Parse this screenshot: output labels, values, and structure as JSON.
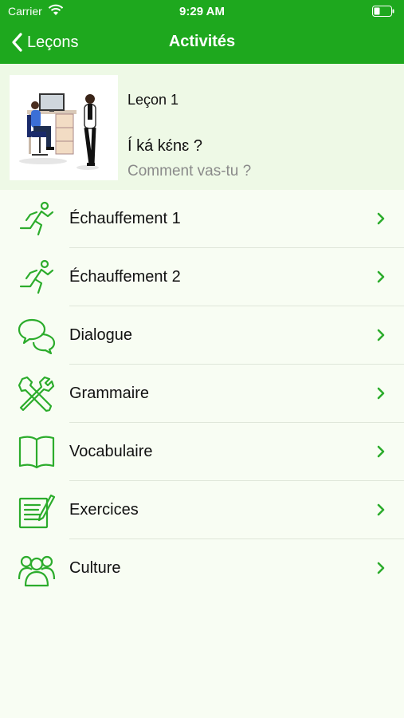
{
  "status_bar": {
    "carrier": "Carrier",
    "time": "9:29 AM"
  },
  "nav": {
    "back_label": "Leçons",
    "title": "Activités"
  },
  "lesson": {
    "number": "Leçon 1",
    "title": "Í ká kɛ́nɛ ?",
    "subtitle": "Comment vas-tu ?"
  },
  "activities": [
    {
      "label": "Échauffement 1",
      "icon": "running-person-icon"
    },
    {
      "label": "Échauffement 2",
      "icon": "running-person-icon"
    },
    {
      "label": "Dialogue",
      "icon": "speech-bubbles-icon"
    },
    {
      "label": "Grammaire",
      "icon": "tools-icon"
    },
    {
      "label": "Vocabulaire",
      "icon": "open-book-icon"
    },
    {
      "label": "Exercices",
      "icon": "notepad-pencil-icon"
    },
    {
      "label": "Culture",
      "icon": "people-group-icon"
    }
  ],
  "colors": {
    "accent": "#1ea81e",
    "background": "#f8fdf3",
    "lesson_background": "#eef9e6"
  }
}
